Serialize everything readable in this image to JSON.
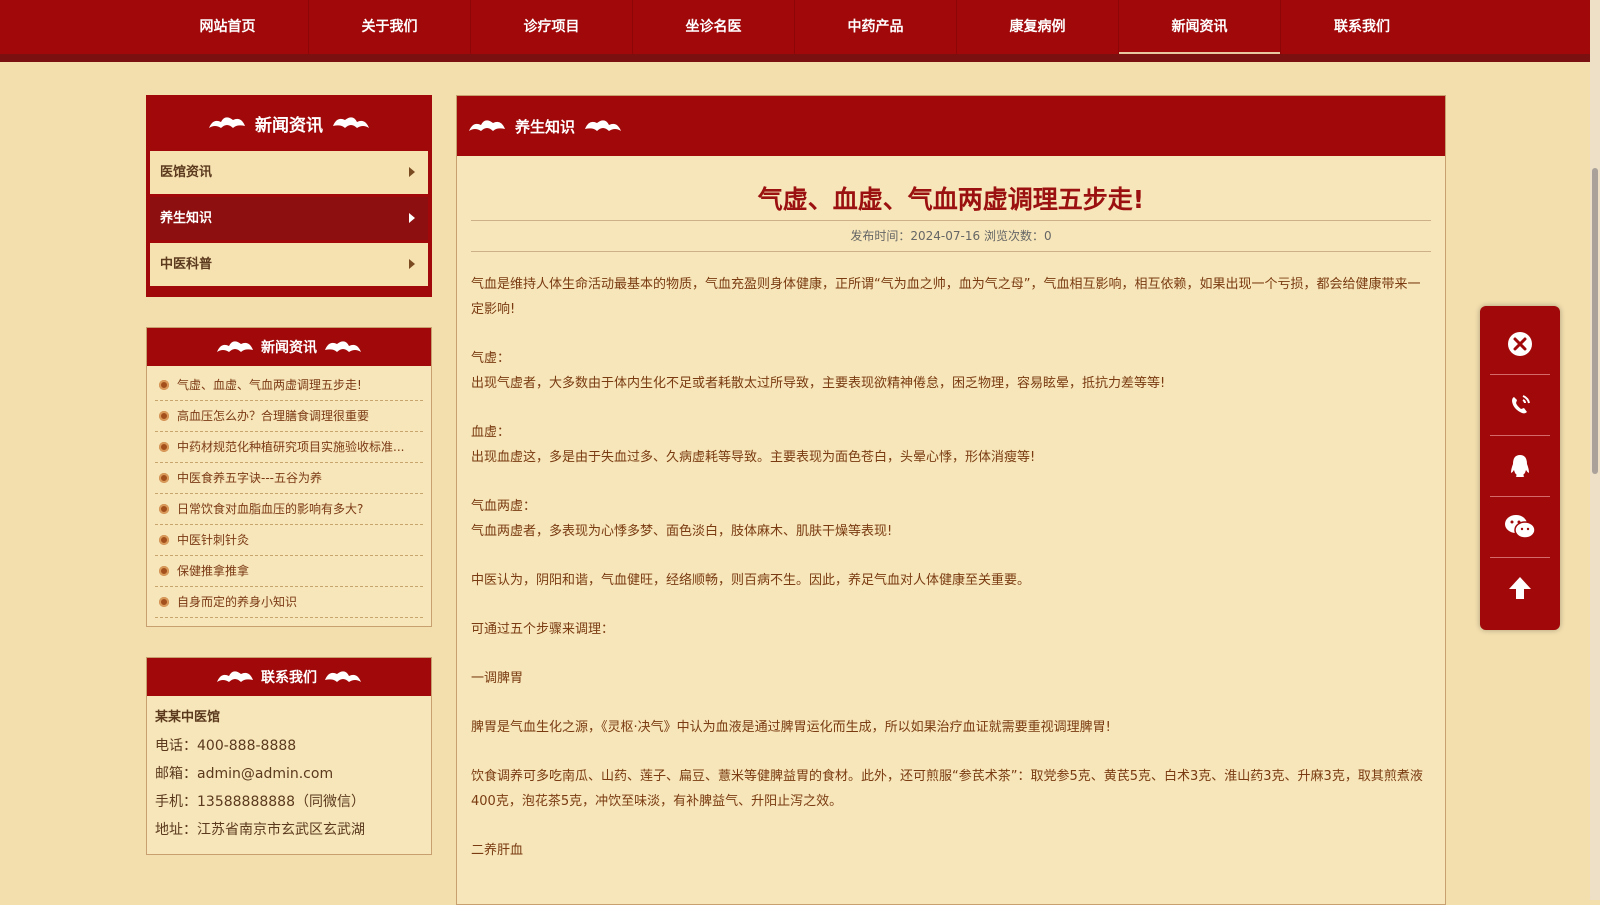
{
  "nav": {
    "items": [
      "网站首页",
      "关于我们",
      "诊疗项目",
      "坐诊名医",
      "中药产品",
      "康复病例",
      "新闻资讯",
      "联系我们"
    ],
    "active": "新闻资讯"
  },
  "sidebar": {
    "menu_title": "新闻资讯",
    "menu_items": [
      "医馆资讯",
      "养生知识",
      "中医科普"
    ],
    "news_title": "新闻资讯",
    "news_items": [
      "气虚、血虚、气血两虚调理五步走!",
      "高血压怎么办？合理膳食调理很重要",
      "中药材规范化种植研究项目实施验收标准...",
      "中医食养五字诀---五谷为养",
      "日常饮食对血脂血压的影响有多大?",
      "中医针刺针灸",
      "保健推拿推拿",
      "自身而定的养身小知识"
    ],
    "contact_title": "联系我们",
    "contact": {
      "name": "某某中医馆",
      "phone": "电话：400-888-8888",
      "email": "邮箱：admin@admin.com",
      "mobile": "手机：13588888888（同微信）",
      "address": "地址：江苏省南京市玄武区玄武湖"
    }
  },
  "main": {
    "section_title": "养生知识",
    "article_title": "气虚、血虚、气血两虚调理五步走!",
    "meta": "发布时间：2024-07-16   浏览次数：0",
    "paragraphs": [
      "气血是维持人体生命活动最基本的物质，气血充盈则身体健康，正所谓“气为血之帅，血为气之母”，气血相互影响，相互依赖，如果出现一个亏损，都会给健康带来一定影响!",
      "气虚：\n出现气虚者，大多数由于体内生化不足或者耗散太过所导致，主要表现欲精神倦怠，困乏物理，容易眩晕，抵抗力差等等!",
      "血虚：\n出现血虚这，多是由于失血过多、久病虚耗等导致。主要表现为面色苍白，头晕心悸，形体消瘦等!",
      "气血两虚：\n气血两虚者，多表现为心悸多梦、面色淡白，肢体麻木、肌肤干燥等表现!",
      "中医认为，阴阳和谐，气血健旺，经络顺畅，则百病不生。因此，养足气血对人体健康至关重要。",
      "可通过五个步骤来调理：",
      "一调脾胃",
      "脾胃是气血生化之源，《灵枢·决气》中认为血液是通过脾胃运化而生成，所以如果治疗血证就需要重视调理脾胃!",
      "饮食调养可多吃南瓜、山药、莲子、扁豆、薏米等健脾益胃的食材。此外，还可煎服“参芪术茶”：取党参5克、黄芪5克、白术3克、淮山药3克、升麻3克，取其煎煮液400克，泡花茶5克，冲饮至味淡，有补脾益气、升阳止泻之效。",
      "二养肝血"
    ]
  },
  "float_buttons": [
    "close-icon",
    "phone-icon",
    "qq-icon",
    "wechat-icon",
    "arrow-up-icon"
  ],
  "colors": {
    "primary": "#a0080a",
    "page_bg": "#f3dfae",
    "text": "#7a3b12"
  }
}
